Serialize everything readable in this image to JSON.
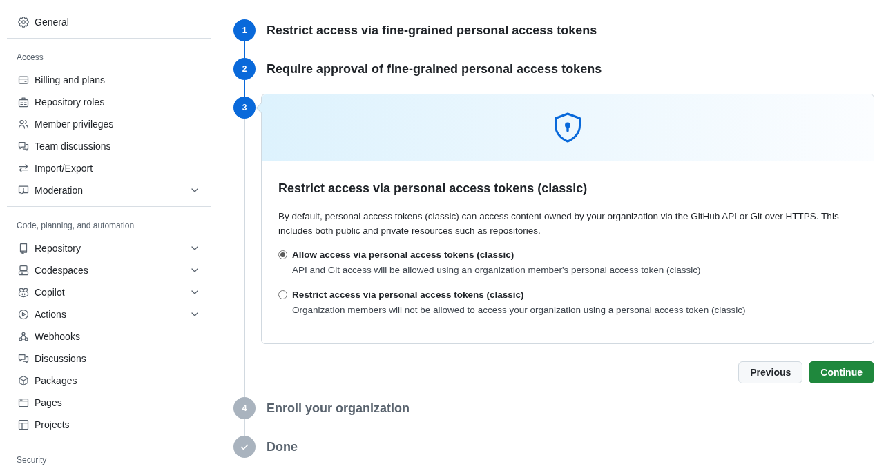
{
  "sidebar": {
    "sections": [
      {
        "items": [
          {
            "label": "General",
            "expandable": false
          }
        ]
      },
      {
        "heading": "Access",
        "items": [
          {
            "label": "Billing and plans",
            "expandable": false
          },
          {
            "label": "Repository roles",
            "expandable": false
          },
          {
            "label": "Member privileges",
            "expandable": false
          },
          {
            "label": "Team discussions",
            "expandable": false
          },
          {
            "label": "Import/Export",
            "expandable": false
          },
          {
            "label": "Moderation",
            "expandable": true
          }
        ]
      },
      {
        "heading": "Code, planning, and automation",
        "items": [
          {
            "label": "Repository",
            "expandable": true
          },
          {
            "label": "Codespaces",
            "expandable": true
          },
          {
            "label": "Copilot",
            "expandable": true
          },
          {
            "label": "Actions",
            "expandable": true
          },
          {
            "label": "Webhooks",
            "expandable": false
          },
          {
            "label": "Discussions",
            "expandable": false
          },
          {
            "label": "Packages",
            "expandable": false
          },
          {
            "label": "Pages",
            "expandable": false
          },
          {
            "label": "Projects",
            "expandable": false
          }
        ]
      },
      {
        "heading": "Security"
      }
    ]
  },
  "steps": [
    {
      "kind": "number",
      "number": "1",
      "active": true,
      "title": "Restrict access via fine-grained personal access tokens"
    },
    {
      "kind": "number",
      "number": "2",
      "active": true,
      "title": "Require approval of fine-grained personal access tokens"
    },
    {
      "kind": "number",
      "number": "3",
      "active": true,
      "panel": {
        "title": "Restrict access via personal access tokens (classic)",
        "description": "By default, personal access tokens (classic) can access content owned by your organization via the GitHub API or Git over HTTPS. This includes both public and private resources such as repositories.",
        "options": [
          {
            "label": "Allow access via personal access tokens (classic)",
            "hint": "API and Git access will be allowed using an organization member's personal access token (classic)",
            "selected": true
          },
          {
            "label": "Restrict access via personal access tokens (classic)",
            "hint": "Organization members will not be allowed to access your organization using a personal access token (classic)",
            "selected": false
          }
        ],
        "buttons": [
          {
            "label": "Previous",
            "kind": "secondary"
          },
          {
            "label": "Continue",
            "kind": "primary"
          }
        ]
      }
    },
    {
      "kind": "number",
      "number": "4",
      "active": false,
      "title": "Enroll your organization"
    },
    {
      "kind": "check",
      "active": false,
      "title": "Done"
    }
  ]
}
